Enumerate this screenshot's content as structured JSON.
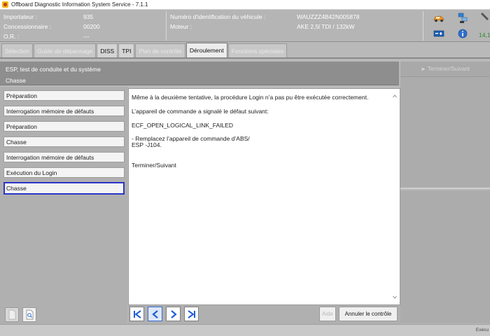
{
  "window": {
    "title": "Offboard Diagnostic Information System Service - 7.1.1"
  },
  "info": {
    "importer_label": "Importateur :",
    "importer_value": "935",
    "dealer_label": "Concessionnaire :",
    "dealer_value": "00200",
    "order_label": "O.R. :",
    "order_value": "---",
    "vin_label": "Numéro d'identification du véhicule :",
    "vin_value": "WAUZZZ4B42N005878",
    "engine_label": "Moteur :",
    "engine_value": "AKE 2,5l TDI / 132kW",
    "version_value": "14,1"
  },
  "tabs": [
    {
      "label": "Sélection"
    },
    {
      "label": "Guide de dépannage"
    },
    {
      "label": "DISS"
    },
    {
      "label": "TPI"
    },
    {
      "label": "Plan de contrôle"
    },
    {
      "label": "Déroulement"
    },
    {
      "label": "Fonctions spéciales"
    }
  ],
  "context": {
    "line1": "ESP, test de conduite et du système",
    "line2": "Chasse"
  },
  "right": {
    "top_button": "Terminer/Suivant"
  },
  "steps": [
    {
      "label": "Préparation"
    },
    {
      "label": "Interrogation mémoire de défauts"
    },
    {
      "label": "Préparation"
    },
    {
      "label": "Chasse"
    },
    {
      "label": "Interrogation mémoire de défauts"
    },
    {
      "label": "Exécution du Login"
    },
    {
      "label": "Chasse"
    }
  ],
  "content": {
    "messages": [
      "Même à la deuxième tentative, la procédure Login n’a pas pu être exécutée correctement.",
      "L’appareil de commande a signalé le défaut suivant:",
      "ECF_OPEN_LOGICAL_LINK_FAILED",
      "- Remplacez l’appareil de commande d’ABS/\nESP -J104.",
      "Terminer/Suivant"
    ]
  },
  "bottom": {
    "help_label": "Aide",
    "cancel_label": "Annuler le contrôle"
  },
  "status": {
    "text": "Exécu"
  },
  "colors": {
    "accent_blue": "#2a36c8",
    "nav_blue": "#1f5fd6"
  }
}
